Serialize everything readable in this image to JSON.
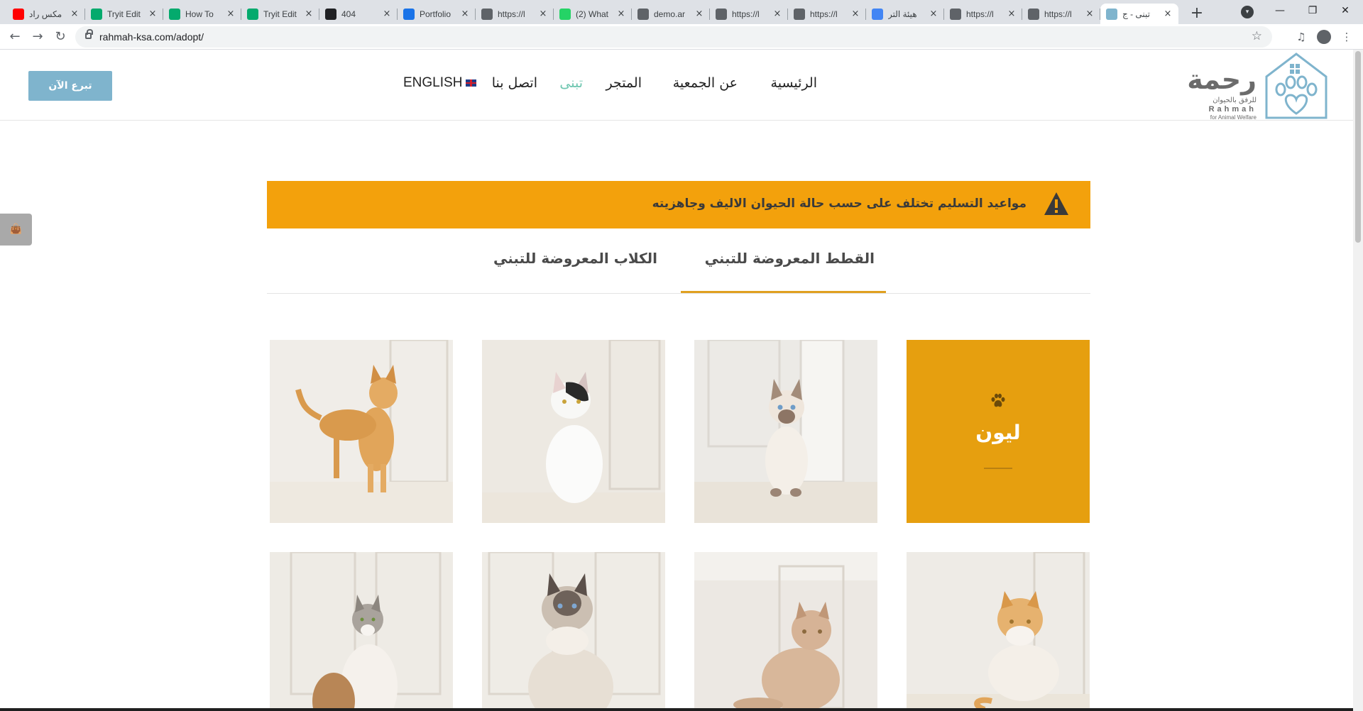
{
  "browser": {
    "tabs": [
      {
        "label": "مكس راد",
        "favicon": "youtube-icon",
        "color": "#ff0000"
      },
      {
        "label": "Tryit Edit",
        "favicon": "w3schools-icon",
        "color": "#04aa6d"
      },
      {
        "label": "How To",
        "favicon": "w3schools-icon",
        "color": "#04aa6d"
      },
      {
        "label": "Tryit Edit",
        "favicon": "w3schools-icon",
        "color": "#04aa6d"
      },
      {
        "label": "404",
        "favicon": "half-circle-icon",
        "color": "#202124"
      },
      {
        "label": "Portfolio",
        "favicon": "portfolio-icon",
        "color": "#1a73e8"
      },
      {
        "label": "https://l",
        "favicon": "globe-icon",
        "color": "#5f6368"
      },
      {
        "label": "(2) What",
        "favicon": "notification-badge-icon",
        "color": "#25d366"
      },
      {
        "label": "demo.ar",
        "favicon": "globe-icon",
        "color": "#5f6368"
      },
      {
        "label": "https://l",
        "favicon": "globe-icon",
        "color": "#5f6368"
      },
      {
        "label": "https://l",
        "favicon": "globe-icon",
        "color": "#5f6368"
      },
      {
        "label": "هيئة التر",
        "favicon": "google-icon",
        "color": "#4285f4"
      },
      {
        "label": "https://l",
        "favicon": "globe-icon",
        "color": "#5f6368"
      },
      {
        "label": "https://l",
        "favicon": "globe-icon",
        "color": "#5f6368"
      },
      {
        "label": "تبنى - ج",
        "favicon": "rahmah-icon",
        "color": "#7fb4cd",
        "active": true
      }
    ],
    "url": "rahmah-ksa.com/adopt/"
  },
  "header": {
    "logo": {
      "arabic": "رحمة",
      "arabic_sub": "للرفق بالحيوان",
      "english": "Rahmah",
      "english_sub": "for Animal Welfare"
    },
    "nav": {
      "home": "الرئيسية",
      "about": "عن الجمعية",
      "store": "المتجر",
      "adopt": "تبنى",
      "contact": "اتصل بنا",
      "english": "ENGLISH"
    },
    "donate_label": "تبرع الآن",
    "accent_color": "#6ec6b0"
  },
  "notice": {
    "text": "مواعيد التسليم تختلف على حسب حالة الحيوان الاليف وجاهزيته",
    "color": "#f3a10c"
  },
  "adopt_tabs": {
    "cats": "القطط المعروضة للتبني",
    "dogs": "الكلاب المعروضة للتبني",
    "active": "cats"
  },
  "grid": {
    "featured_name": "ليون",
    "featured_color": "#e69f0f",
    "photos": [
      "orange-cat-photo",
      "white-black-cat-photo",
      "siamese-cat-photo",
      "calico-cat-photo",
      "fluffy-gray-cat-photo",
      "cream-cat-photo",
      "orange-white-cat-photo"
    ]
  }
}
